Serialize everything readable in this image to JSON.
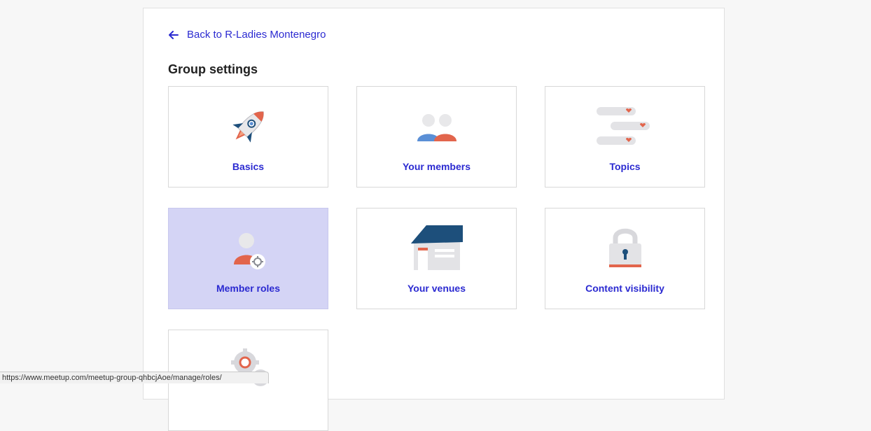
{
  "header": {
    "back_label": "Back to R-Ladies Montenegro",
    "title": "Group settings"
  },
  "tiles": [
    {
      "label": "Basics",
      "icon": "rocket-icon"
    },
    {
      "label": "Your members",
      "icon": "members-icon"
    },
    {
      "label": "Topics",
      "icon": "topics-icon"
    },
    {
      "label": "Member roles",
      "icon": "member-roles-icon",
      "state": "hovered"
    },
    {
      "label": "Your venues",
      "icon": "house-icon"
    },
    {
      "label": "Content visibility",
      "icon": "padlock-icon"
    },
    {
      "label": "",
      "icon": "gears-icon"
    }
  ],
  "status_bar": {
    "url": "https://www.meetup.com/meetup-group-qhbcjAoe/manage/roles/"
  },
  "colors": {
    "accent": "#2b2ad1",
    "hover_background": "#d4d4f5",
    "icon_red": "#e2654c",
    "icon_blue": "#5a8fd6",
    "icon_navy": "#1d4f7b"
  }
}
